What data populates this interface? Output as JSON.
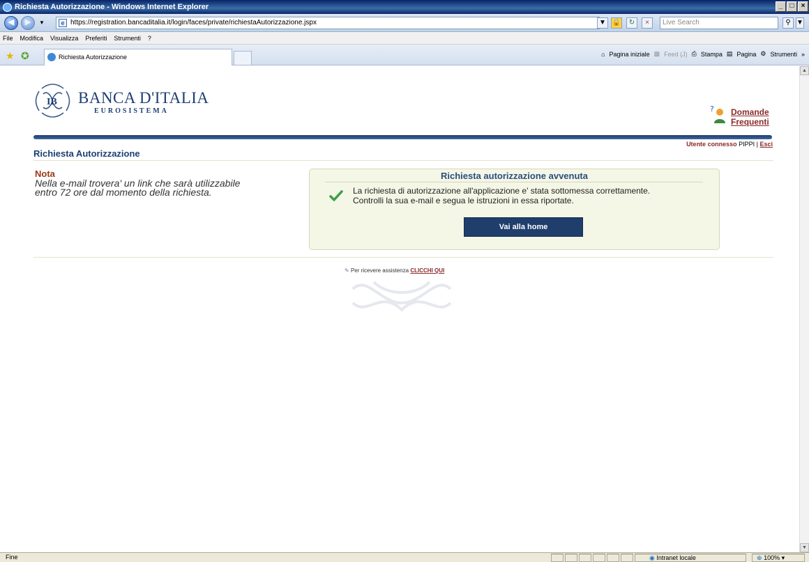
{
  "window": {
    "title": "Richiesta Autorizzazione - Windows Internet Explorer",
    "controls": [
      "_",
      "□",
      "×"
    ]
  },
  "address_bar": {
    "url": "https://registration.bancaditalia.it/login/faces/private/richiestaAutorizzazione.jspx",
    "search_placeholder": "Live Search"
  },
  "menu": {
    "items": [
      "File",
      "Modifica",
      "Visualizza",
      "Preferiti",
      "Strumenti",
      "?"
    ]
  },
  "tabs": {
    "active": "Richiesta Autorizzazione"
  },
  "command_bar": {
    "home": "Pagina iniziale",
    "feed": "Feed (J)",
    "print": "Stampa",
    "page": "Pagina",
    "tools": "Strumenti",
    "more": "»"
  },
  "header": {
    "logo_title": "BANCA D'ITALIA",
    "logo_subtitle": "EUROSISTEMA",
    "faq_line1": "Domande",
    "faq_line2": "Frequenti",
    "user_label": "Utente connesso",
    "user_name": "PIPPI",
    "separator": "|",
    "logout": "Esci"
  },
  "page": {
    "title": "Richiesta Autorizzazione",
    "note_heading": "Nota",
    "note_text": "Nella e-mail trovera' un link che sarà utilizzabile entro 72 ore dal momento della richiesta.",
    "box_title": "Richiesta autorizzazione avvenuta",
    "box_line1": "La richiesta di autorizzazione all'applicazione e' stata sottomessa correttamente.",
    "box_line2": "Controlli la sua e-mail e segua le istruzioni in essa riportate.",
    "home_button": "Vai alla home",
    "assist_text": "Per ricevere assistenza",
    "assist_link": "CLICCHI QUI"
  },
  "status_bar": {
    "status": "Fine",
    "zone": "Intranet locale",
    "zoom": "100%"
  }
}
